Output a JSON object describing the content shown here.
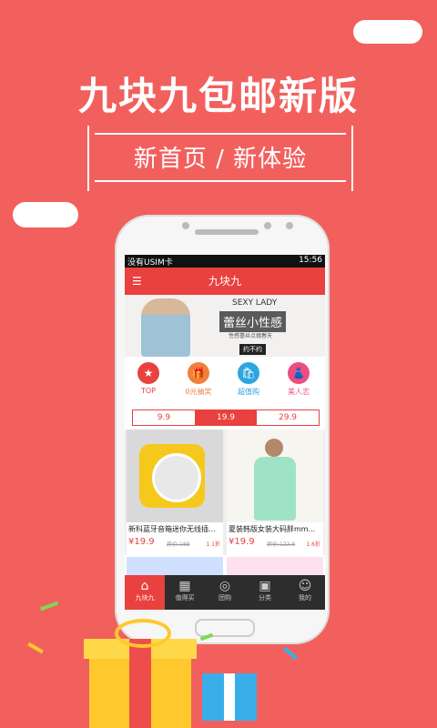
{
  "promo": {
    "headline": "九块九包邮新版",
    "subtitle": "新首页 / 新体验"
  },
  "status_bar": {
    "carrier": "没有USIM卡",
    "time": "15:56"
  },
  "app_bar": {
    "title": "九块九"
  },
  "banner": {
    "en": "SEXY LADY",
    "title": "蕾丝小性感",
    "sub": "性感蕾丝点缀春天",
    "tag": "约不约"
  },
  "categories": [
    {
      "label": "TOP",
      "icon": "★",
      "color": "#e8413f"
    },
    {
      "label": "0元抽奖",
      "icon": "🎁",
      "color": "#f0803c"
    },
    {
      "label": "超值购",
      "icon": "🛍",
      "color": "#2ca6e0"
    },
    {
      "label": "美人志",
      "icon": "👗",
      "color": "#ef4d7f"
    }
  ],
  "price_tabs": [
    "9.9",
    "19.9",
    "29.9"
  ],
  "products": [
    {
      "name": "新科蓝牙音箱迷你无线插...",
      "price": "¥19.9",
      "original": "原价:188",
      "discount": "1.1折"
    },
    {
      "name": "夏装韩版女装大码胖mm...",
      "price": "¥19.9",
      "original": "原价:122.8",
      "discount": "1.6折"
    }
  ],
  "nav": [
    "九块九",
    "值得买",
    "团购",
    "分类",
    "我的"
  ]
}
